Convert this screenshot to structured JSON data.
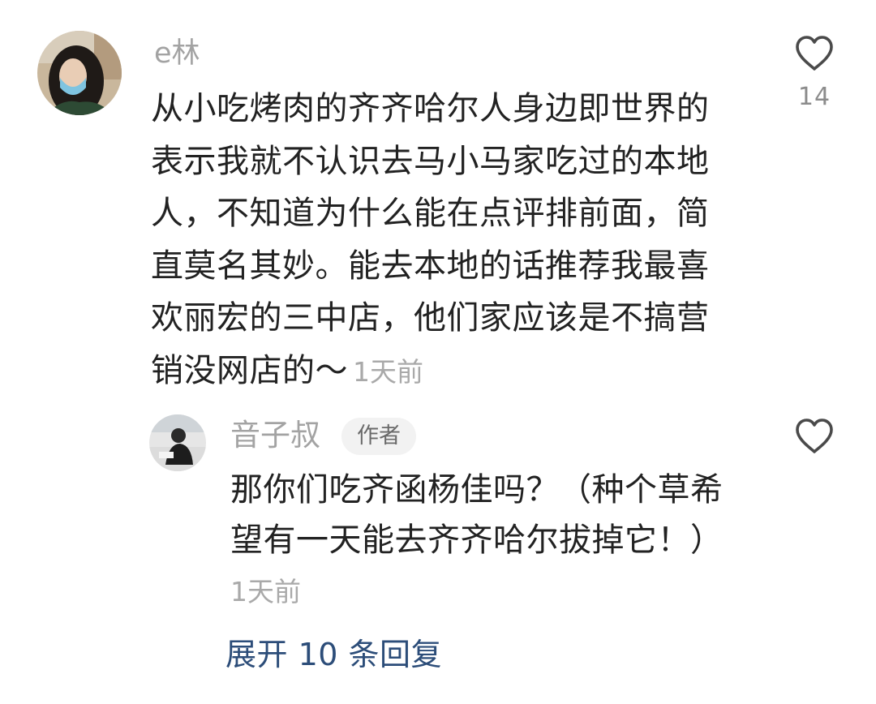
{
  "comment": {
    "username": "e林",
    "text": "从小吃烤肉的齐齐哈尔人身边即世界的表示我就不认识去马小马家吃过的本地人，不知道为什么能在点评排前面，简直莫名其妙。能去本地的话推荐我最喜欢丽宏的三中店，他们家应该是不搞营销没网店的～",
    "time": "1天前",
    "like_count": "14",
    "icons": {
      "avatar": "avatar-woman-with-mask",
      "like": "heart-outline-icon"
    }
  },
  "reply": {
    "username": "音子叔",
    "badge": "作者",
    "text": "那你们吃齐函杨佳吗？（种个草希望有一天能去齐齐哈尔拔掉它！）",
    "time": "1天前",
    "icons": {
      "avatar": "avatar-person-seated",
      "like": "heart-outline-icon"
    }
  },
  "expand_replies_label": "展开 10 条回复",
  "colors": {
    "link": "#2c4d79",
    "secondary_text": "#a3a3a3",
    "body_text": "#222222"
  }
}
